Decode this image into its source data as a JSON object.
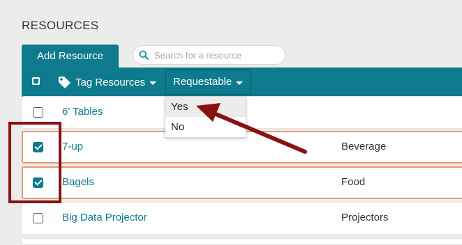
{
  "page": {
    "title": "RESOURCES"
  },
  "toolbar": {
    "add_button_label": "Add Resource",
    "search_placeholder": "Search for a resource",
    "tag_resources_label": "Tag Resources",
    "requestable_label": "Requestable"
  },
  "requestable_menu": {
    "options": [
      {
        "label": "Yes",
        "highlighted": true
      },
      {
        "label": "No",
        "highlighted": false
      }
    ]
  },
  "rows": [
    {
      "name": "6' Tables",
      "category": "",
      "checked": false
    },
    {
      "name": "7-up",
      "category": "Beverage",
      "checked": true
    },
    {
      "name": "Bagels",
      "category": "Food",
      "checked": true
    },
    {
      "name": "Big Data Projector",
      "category": "Projectors",
      "checked": false
    }
  ],
  "colors": {
    "accent": "#0e7a8e",
    "selected_row_border": "#e59a73",
    "annotation": "#8b1111",
    "background": "#ececec"
  },
  "icons": [
    "search-icon",
    "tag-icon",
    "chevron-down-icon",
    "checkbox-icon"
  ]
}
